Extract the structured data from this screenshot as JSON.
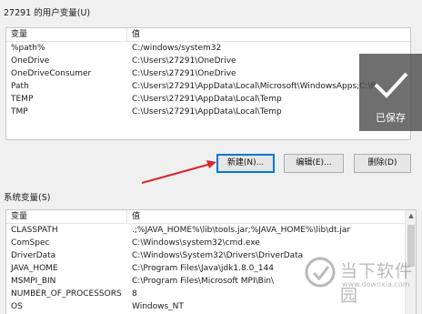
{
  "user_vars": {
    "title": "27291 的用户变量(U)",
    "col_var": "变量",
    "col_val": "值",
    "rows": [
      {
        "name": "%path%",
        "value": "C:/windows/system32"
      },
      {
        "name": "OneDrive",
        "value": "C:\\Users\\27291\\OneDrive"
      },
      {
        "name": "OneDriveConsumer",
        "value": "C:\\Users\\27291\\OneDrive"
      },
      {
        "name": "Path",
        "value": "C:\\Users\\27291\\AppData\\Local\\Microsoft\\WindowsApps;C:\\Pr"
      },
      {
        "name": "TEMP",
        "value": "C:\\Users\\27291\\AppData\\Local\\Temp"
      },
      {
        "name": "TMP",
        "value": "C:\\Users\\27291\\AppData\\Local\\Temp"
      }
    ],
    "buttons": {
      "new": "新建(N)...",
      "edit": "编辑(E)...",
      "delete": "删除(D)"
    }
  },
  "system_vars": {
    "title": "系统变量(S)",
    "col_var": "变量",
    "col_val": "值",
    "rows": [
      {
        "name": "CLASSPATH",
        "value": ".;%JAVA_HOME%\\lib\\tools.jar;%JAVA_HOME%\\lib\\dt.jar"
      },
      {
        "name": "ComSpec",
        "value": "C:\\Windows\\system32\\cmd.exe"
      },
      {
        "name": "DriverData",
        "value": "C:\\Windows\\System32\\Drivers\\DriverData"
      },
      {
        "name": "JAVA_HOME",
        "value": "C:\\Program Files\\Java\\jdk1.8.0_144"
      },
      {
        "name": "MSMPI_BIN",
        "value": "C:\\Program Files\\Microsoft MPI\\Bin\\"
      },
      {
        "name": "NUMBER_OF_PROCESSORS",
        "value": "8"
      },
      {
        "name": "OS",
        "value": "Windows_NT"
      }
    ]
  },
  "toast": {
    "label": "已保存",
    "icon": "check-icon"
  },
  "watermark": {
    "main": "当下软件园",
    "sub": "www.downxia.com"
  },
  "colors": {
    "annotation_arrow": "#d6262b",
    "focus_border": "#0078d7"
  }
}
